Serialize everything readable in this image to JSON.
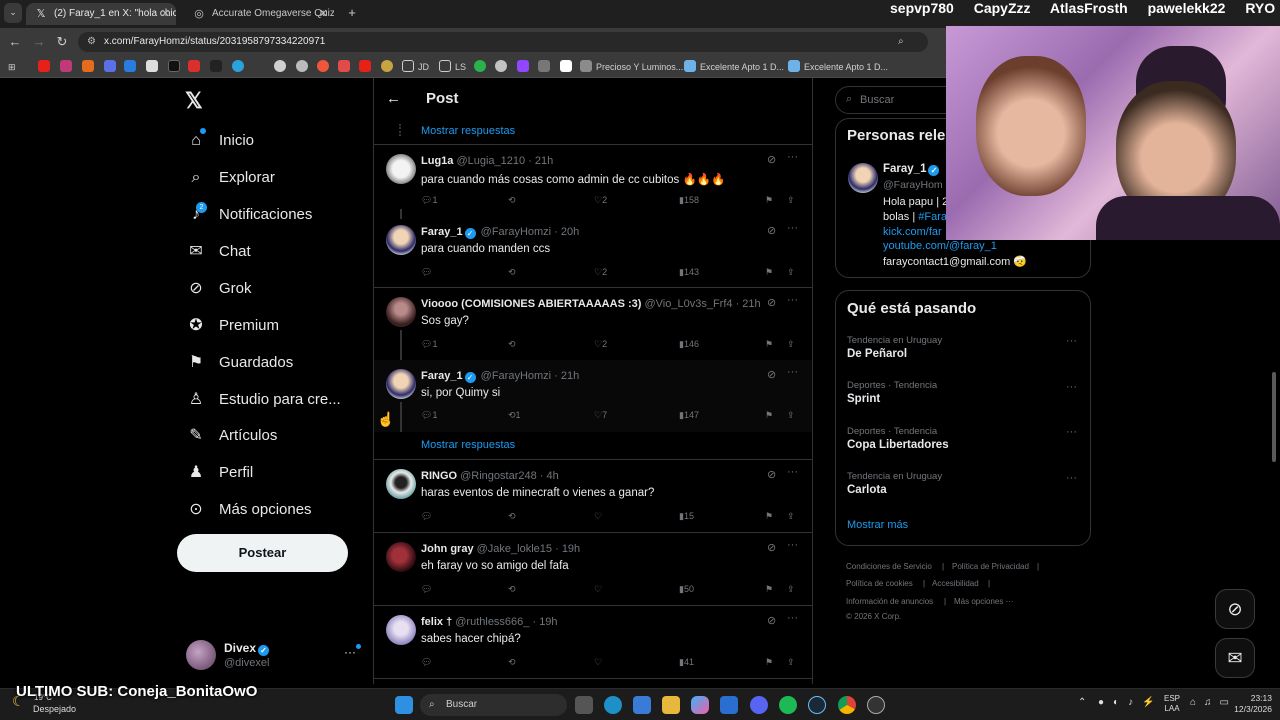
{
  "browser": {
    "tabs": [
      {
        "title": "(2) Faray_1 en X: \"hola chicos s",
        "icon": "x-logo-icon"
      },
      {
        "title": "Accurate Omegaverse Quiz - 1(",
        "icon": "quiz-icon"
      }
    ],
    "new_tab": "+",
    "url": "x.com/FarayHomzi/status/2031958797334220971",
    "bookmarks": [
      {
        "label": "JD",
        "type": "folder"
      },
      {
        "label": "LS",
        "type": "folder"
      },
      {
        "label": "Precioso Y Luminos...",
        "type": "link"
      },
      {
        "label": "Excelente Apto 1 D...",
        "type": "link"
      },
      {
        "label": "Excelente Apto 1 D...",
        "type": "link"
      }
    ]
  },
  "stream": {
    "names": [
      "sepvp780",
      "CapyZzz",
      "AtlasFrosth",
      "pawelekk22",
      "RYO"
    ],
    "last_sub": "ULTIMO SUB: Coneja_BonitaOwO"
  },
  "sidebar": {
    "items": [
      {
        "label": "Inicio",
        "icon": "home-icon"
      },
      {
        "label": "Explorar",
        "icon": "search-icon"
      },
      {
        "label": "Notificaciones",
        "icon": "bell-icon",
        "badge": "2"
      },
      {
        "label": "Chat",
        "icon": "mail-icon"
      },
      {
        "label": "Grok",
        "icon": "grok-icon"
      },
      {
        "label": "Premium",
        "icon": "verified-icon"
      },
      {
        "label": "Guardados",
        "icon": "bookmark-icon"
      },
      {
        "label": "Estudio para cre...",
        "icon": "studio-icon"
      },
      {
        "label": "Artículos",
        "icon": "article-icon"
      },
      {
        "label": "Perfil",
        "icon": "person-icon"
      },
      {
        "label": "Más opciones",
        "icon": "more-circle-icon"
      }
    ],
    "post_button": "Postear",
    "account": {
      "name": "Divex",
      "handle": "@divexel"
    }
  },
  "main": {
    "header_title": "Post",
    "show_replies": "Mostrar respuestas",
    "tweets": [
      {
        "name": "Lug1a",
        "handle": "@Lugia_1210",
        "time": "· 21h",
        "text": "para cuando más cosas como admin de cc cubitos 🔥🔥🔥",
        "replies": "1",
        "retweets": "",
        "likes": "2",
        "views": "158",
        "verified": false
      },
      {
        "name": "Faray_1",
        "handle": "@FarayHomzi",
        "time": "· 20h",
        "text": "para cuando manden ccs",
        "replies": "",
        "retweets": "",
        "likes": "2",
        "views": "143",
        "verified": true
      },
      {
        "name": "Vioooo (COMISIONES ABIERTAAAAAS :3)",
        "handle": "@Vio_L0v3s_Frf4",
        "time": "· 21h",
        "text": "Sos gay?",
        "replies": "1",
        "retweets": "",
        "likes": "2",
        "views": "146",
        "verified": false
      },
      {
        "name": "Faray_1",
        "handle": "@FarayHomzi",
        "time": "· 21h",
        "text": "si, por Quimy si",
        "replies": "1",
        "retweets": "1",
        "likes": "7",
        "views": "147",
        "verified": true
      },
      {
        "name": "RINGO",
        "handle": "@Ringostar248",
        "time": "· 4h",
        "text": "haras eventos de minecraft o vienes a ganar?",
        "replies": "",
        "retweets": "",
        "likes": "",
        "views": "15",
        "verified": false
      },
      {
        "name": "John gray",
        "handle": "@Jake_lokle15",
        "time": "· 19h",
        "text": "eh faray vo so amigo del fafa",
        "replies": "",
        "retweets": "",
        "likes": "",
        "views": "50",
        "verified": false
      },
      {
        "name": "felix †",
        "handle": "@ruthless666_",
        "time": "· 19h",
        "text": "sabes hacer chipá?",
        "replies": "",
        "retweets": "",
        "likes": "",
        "views": "41",
        "verified": false
      }
    ]
  },
  "right": {
    "search_placeholder": "Buscar",
    "relevant_title": "Personas rele",
    "profile": {
      "name": "Faray_1",
      "handle": "@FarayHom",
      "bio1": "Hola papu | 2",
      "bio2": "bolas | ",
      "bio2_link": "#Fara",
      "link1": "kick.com/far",
      "link2": "youtube.com/@faray_1",
      "email": "faraycontact1@gmail.com 🤕"
    },
    "trending_title": "Qué está pasando",
    "trends": [
      {
        "meta": "Tendencia en Uruguay",
        "name": "De Peñarol"
      },
      {
        "meta": "Deportes · Tendencia",
        "name": "Sprint"
      },
      {
        "meta": "Deportes · Tendencia",
        "name": "Copa Libertadores"
      },
      {
        "meta": "Tendencia en Uruguay",
        "name": "Carlota"
      }
    ],
    "show_more": "Mostrar más",
    "footer": [
      "Condiciones de Servicio",
      "Política de Privacidad",
      "Política de cookies",
      "Accesibilidad",
      "Información de anuncios",
      "Más opciones ···",
      "© 2026 X Corp."
    ]
  },
  "taskbar": {
    "weather_temp": "19°C",
    "weather_desc": "Despejado",
    "search": "Buscar",
    "lang1": "ESP",
    "lang2": "LAA",
    "time": "23:13",
    "date": "12/3/2026"
  }
}
